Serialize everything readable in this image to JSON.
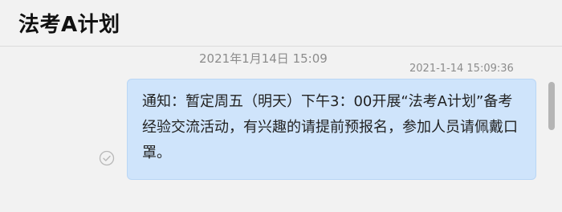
{
  "header": {
    "title": "法考A计划"
  },
  "conversation": {
    "date_divider": "2021年1月14日 15:09",
    "message": {
      "timestamp": "2021-1-14 15:09:36",
      "text": "通知：暂定周五（明天）下午3：00开展“法考A计划”备考经验交流活动，有兴趣的请提前预报名，参加人员请佩戴口罩。",
      "status_icon": "check-circle-icon"
    }
  },
  "colors": {
    "bubble": "#cfe4fb",
    "background": "#f2f2f2"
  }
}
